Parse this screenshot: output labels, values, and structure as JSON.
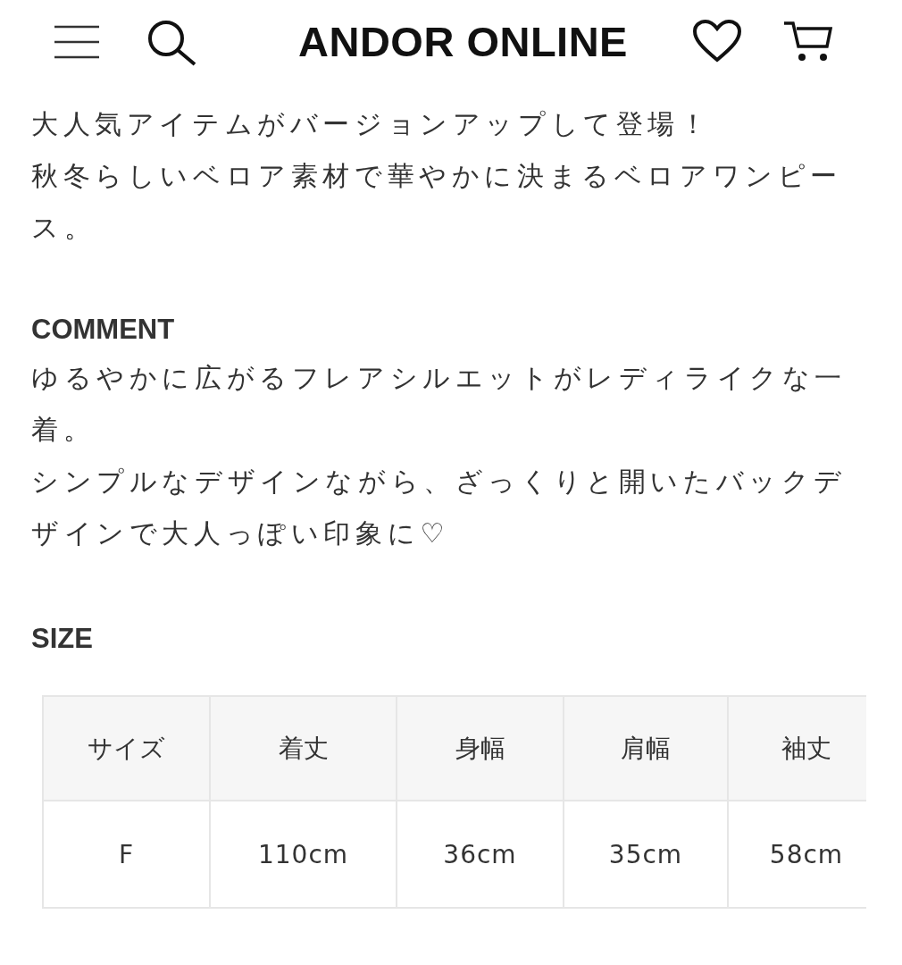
{
  "header": {
    "logo": "ANDOR ONLINE"
  },
  "intro": [
    "大人気アイテムがバージョンアップして登場！",
    "秋冬らしいベロア素材で華やかに決まるベロアワンピース。"
  ],
  "comment": {
    "heading": "COMMENT",
    "paragraphs": [
      "ゆるやかに広がるフレアシルエットがレディライクな一着。",
      "シンプルなデザインながら、ざっくりと開いたバックデザインで大人っぽい印象に♡"
    ]
  },
  "size": {
    "heading": "SIZE",
    "table": {
      "columns": [
        "サイズ",
        "着丈",
        "身幅",
        "肩幅",
        "袖丈"
      ],
      "rows": [
        [
          "F",
          "110cm",
          "36cm",
          "35cm",
          "58cm"
        ]
      ]
    }
  }
}
